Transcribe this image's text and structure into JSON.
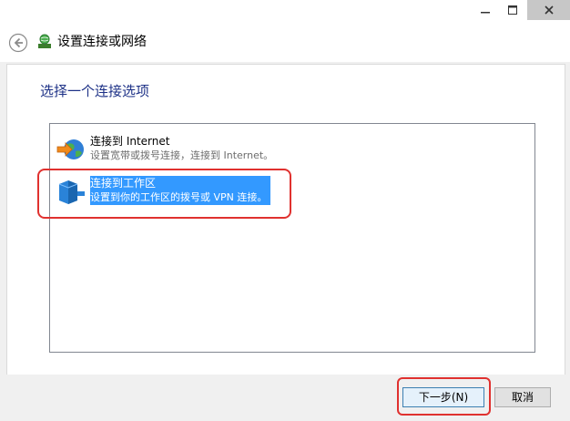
{
  "window": {
    "controls": {
      "minimize_icon": "minimize-icon",
      "maximize_icon": "maximize-icon",
      "close_icon": "close-icon"
    }
  },
  "header": {
    "title": "设置连接或网络",
    "back_icon": "back-arrow-icon",
    "app_icon": "network-globe-icon"
  },
  "main": {
    "heading": "选择一个连接选项",
    "options": [
      {
        "title": "连接到 Internet",
        "description": "设置宽带或拨号连接，连接到 Internet。",
        "icon": "internet-globe-icon",
        "selected": false
      },
      {
        "title": "连接到工作区",
        "description": "设置到你的工作区的拨号或 VPN 连接。",
        "icon": "workplace-connection-icon",
        "selected": true
      }
    ]
  },
  "footer": {
    "next_label": "下一步(N)",
    "cancel_label": "取消"
  },
  "colors": {
    "selection": "#3399ff",
    "heading": "#1e3287",
    "annotation": "#e0312f"
  }
}
